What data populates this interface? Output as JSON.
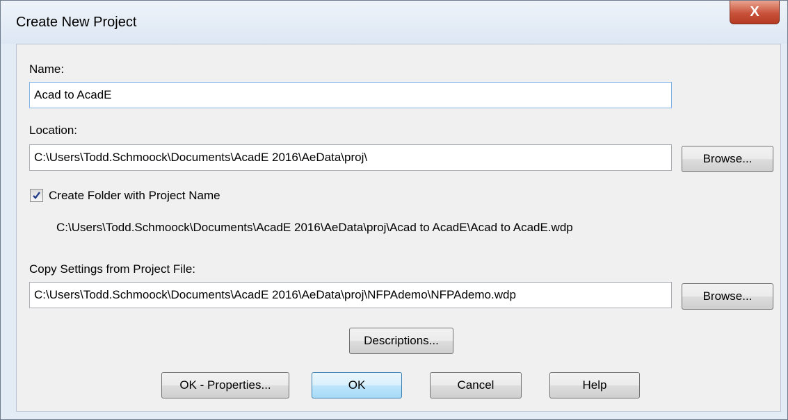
{
  "window": {
    "title": "Create New Project",
    "close_glyph": "X"
  },
  "name": {
    "label": "Name:",
    "value": "Acad to AcadE"
  },
  "location": {
    "label": "Location:",
    "value": "C:\\Users\\Todd.Schmoock\\Documents\\AcadE 2016\\AeData\\proj\\",
    "browse_label": "Browse..."
  },
  "create_folder": {
    "label": "Create Folder with Project Name",
    "checked": true,
    "path_preview": "C:\\Users\\Todd.Schmoock\\Documents\\AcadE 2016\\AeData\\proj\\Acad to AcadE\\Acad to AcadE.wdp"
  },
  "copy_settings": {
    "label": "Copy Settings from Project File:",
    "value": "C:\\Users\\Todd.Schmoock\\Documents\\AcadE 2016\\AeData\\proj\\NFPAdemo\\NFPAdemo.wdp",
    "browse_label": "Browse..."
  },
  "buttons": {
    "descriptions": "Descriptions...",
    "ok_properties": "OK - Properties...",
    "ok": "OK",
    "cancel": "Cancel",
    "help": "Help"
  }
}
